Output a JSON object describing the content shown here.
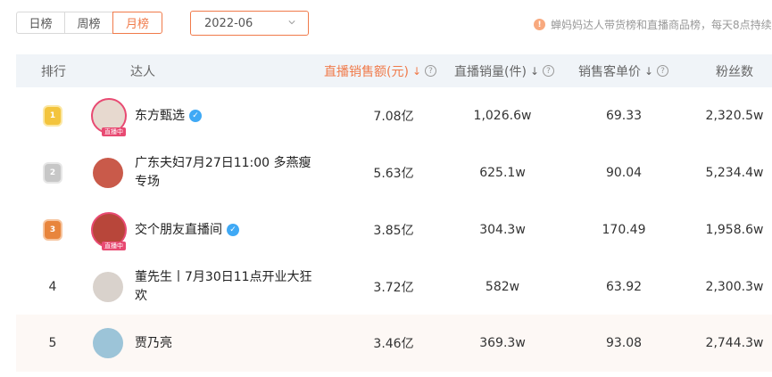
{
  "tabs": [
    "日榜",
    "周榜",
    "月榜"
  ],
  "active_tab": "月榜",
  "month_picker": {
    "value": "2022-06"
  },
  "notice": {
    "text": "蝉妈妈达人带货榜和直播商品榜，每天8点持续更"
  },
  "columns": {
    "rank": "排行",
    "influencer": "达人",
    "sales_amount": "直播销售额(元)",
    "sales_volume": "直播销量(件)",
    "unit_price": "销售客单价",
    "fans": "粉丝数"
  },
  "rows": [
    {
      "rank": "1",
      "rank_icon": "gold-medal-icon",
      "name": "东方甄选",
      "verified": true,
      "live_tag": "直播中",
      "sales_amount": "7.08亿",
      "sales_volume": "1,026.6w",
      "unit_price": "69.33",
      "fans": "2,320.5w"
    },
    {
      "rank": "2",
      "rank_icon": "silver-medal-icon",
      "name": "广东夫妇7月27日11:00 多燕瘦专场",
      "verified": false,
      "live_tag": "",
      "sales_amount": "5.63亿",
      "sales_volume": "625.1w",
      "unit_price": "90.04",
      "fans": "5,234.4w"
    },
    {
      "rank": "3",
      "rank_icon": "bronze-medal-icon",
      "name": "交个朋友直播间",
      "verified": true,
      "live_tag": "直播中",
      "sales_amount": "3.85亿",
      "sales_volume": "304.3w",
      "unit_price": "170.49",
      "fans": "1,958.6w"
    },
    {
      "rank": "4",
      "rank_icon": "",
      "name": "董先生丨7月30日11点开业大狂欢",
      "verified": false,
      "live_tag": "",
      "sales_amount": "3.72亿",
      "sales_volume": "582w",
      "unit_price": "63.92",
      "fans": "2,300.3w"
    },
    {
      "rank": "5",
      "rank_icon": "",
      "name": "贾乃亮",
      "verified": false,
      "live_tag": "",
      "sales_amount": "3.46亿",
      "sales_volume": "369.3w",
      "unit_price": "93.08",
      "fans": "2,744.3w"
    }
  ],
  "colors": {
    "accent": "#f07a4a",
    "header_bg": "#f0f4f8",
    "live": "#e84a72",
    "verified": "#3fa9f5"
  }
}
